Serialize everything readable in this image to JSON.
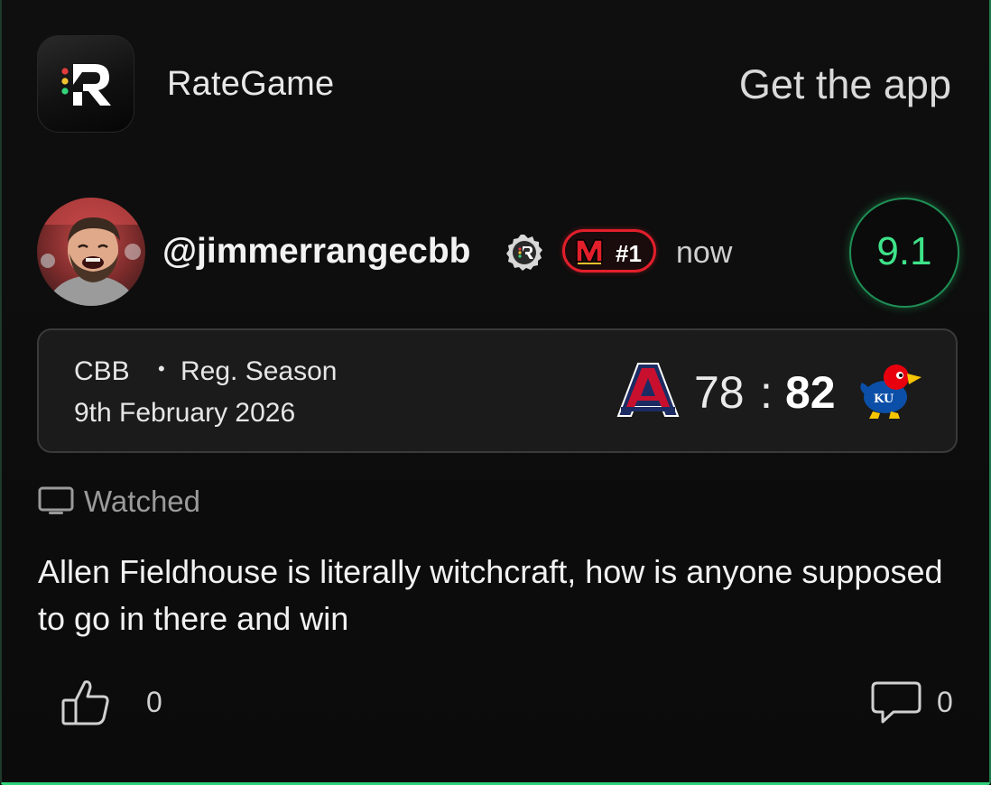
{
  "header": {
    "app_name": "RateGame",
    "get_app_label": "Get the app",
    "icons": {
      "app_logo": "rategame-logo"
    }
  },
  "post": {
    "username": "@jimmerrangecbb",
    "time_ago": "now",
    "rating": "9.1",
    "badges": {
      "verified": "rategame-badge-icon",
      "team_logo": "maryland-m-logo",
      "team_rank": "#1"
    },
    "colors": {
      "rating_green": "#3ee38a",
      "team_red": "#e21f2b"
    }
  },
  "game": {
    "league": "CBB",
    "separator": "•",
    "season": "Reg. Season",
    "date": "9th February 2026",
    "away_team_logo": "arizona-logo",
    "away_score": "78",
    "score_separator": ":",
    "home_score": "82",
    "home_team_logo": "kansas-jayhawk-logo"
  },
  "watched": {
    "icon": "tv-icon",
    "label": "Watched"
  },
  "review": {
    "text": "Allen Fieldhouse is literally witchcraft, how is anyone supposed to go in there and win"
  },
  "footer": {
    "like_icon": "thumbs-up-icon",
    "like_count": "0",
    "comment_icon": "comment-icon",
    "comment_count": "0"
  }
}
